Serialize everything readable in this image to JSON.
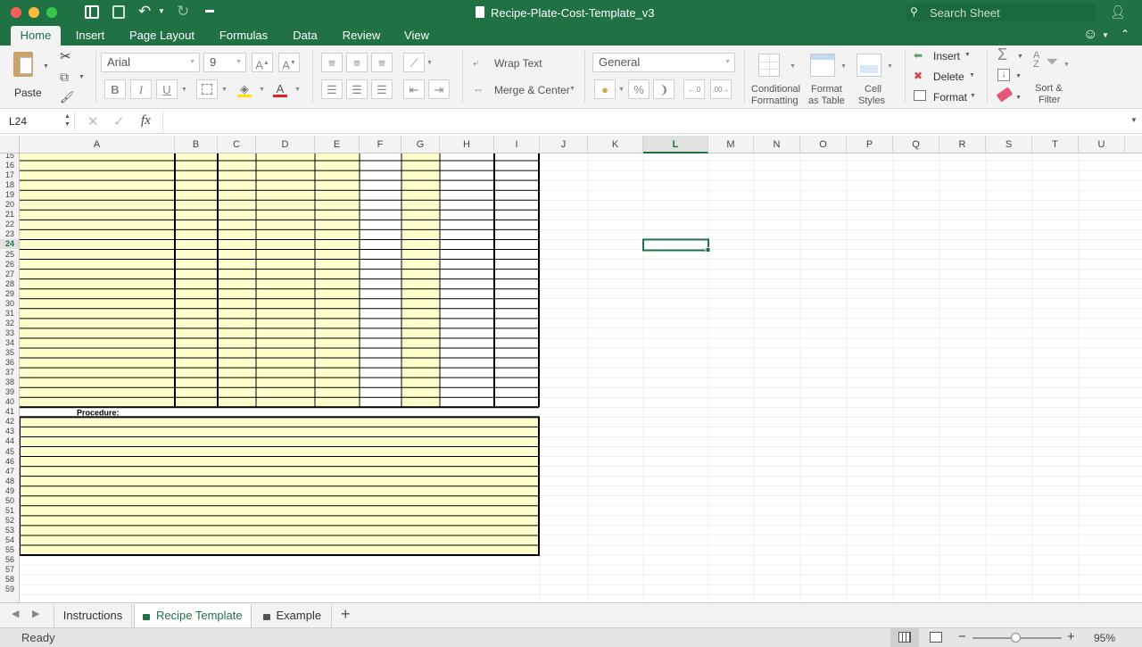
{
  "window": {
    "title": "Recipe-Plate-Cost-Template_v3",
    "search_placeholder": "Search Sheet"
  },
  "ribbon_tabs": [
    {
      "label": "Home",
      "active": true
    },
    {
      "label": "Insert"
    },
    {
      "label": "Page Layout"
    },
    {
      "label": "Formulas"
    },
    {
      "label": "Data"
    },
    {
      "label": "Review"
    },
    {
      "label": "View"
    }
  ],
  "clipboard": {
    "paste_label": "Paste"
  },
  "font": {
    "name": "Arial",
    "size": "9",
    "bold": "B",
    "italic": "I",
    "underline": "U"
  },
  "alignment": {
    "wrap_text": "Wrap Text",
    "merge_center": "Merge & Center"
  },
  "number": {
    "format": "General",
    "percent": "%"
  },
  "styles": {
    "conditional_line1": "Conditional",
    "conditional_line2": "Formatting",
    "table_line1": "Format",
    "table_line2": "as Table",
    "cell_line1": "Cell",
    "cell_line2": "Styles"
  },
  "cells": {
    "insert": "Insert",
    "delete": "Delete",
    "format": "Format"
  },
  "editing": {
    "sort_line1": "Sort &",
    "sort_line2": "Filter"
  },
  "formula_bar": {
    "name_box": "L24",
    "fx": "fx",
    "value": ""
  },
  "columns": [
    "A",
    "B",
    "C",
    "D",
    "E",
    "F",
    "G",
    "H",
    "I",
    "J",
    "K",
    "L",
    "M",
    "N",
    "O",
    "P",
    "Q",
    "R",
    "S",
    "T",
    "U"
  ],
  "selected_column": "L",
  "selected_row": 24,
  "rows": {
    "first": 15,
    "last": 59
  },
  "sheet": {
    "procedure_label": "Procedure:"
  },
  "sheet_tabs": [
    {
      "label": "Instructions",
      "locked": false,
      "active": false
    },
    {
      "label": "Recipe Template",
      "locked": true,
      "active": true
    },
    {
      "label": "Example",
      "locked": true,
      "active": false
    }
  ],
  "status": {
    "ready": "Ready",
    "zoom": "95%"
  },
  "colors": {
    "accent": "#207245",
    "input_fill": "#ffffcc",
    "grid_line": "#000000",
    "gridline_light": "#e2e2e2"
  }
}
